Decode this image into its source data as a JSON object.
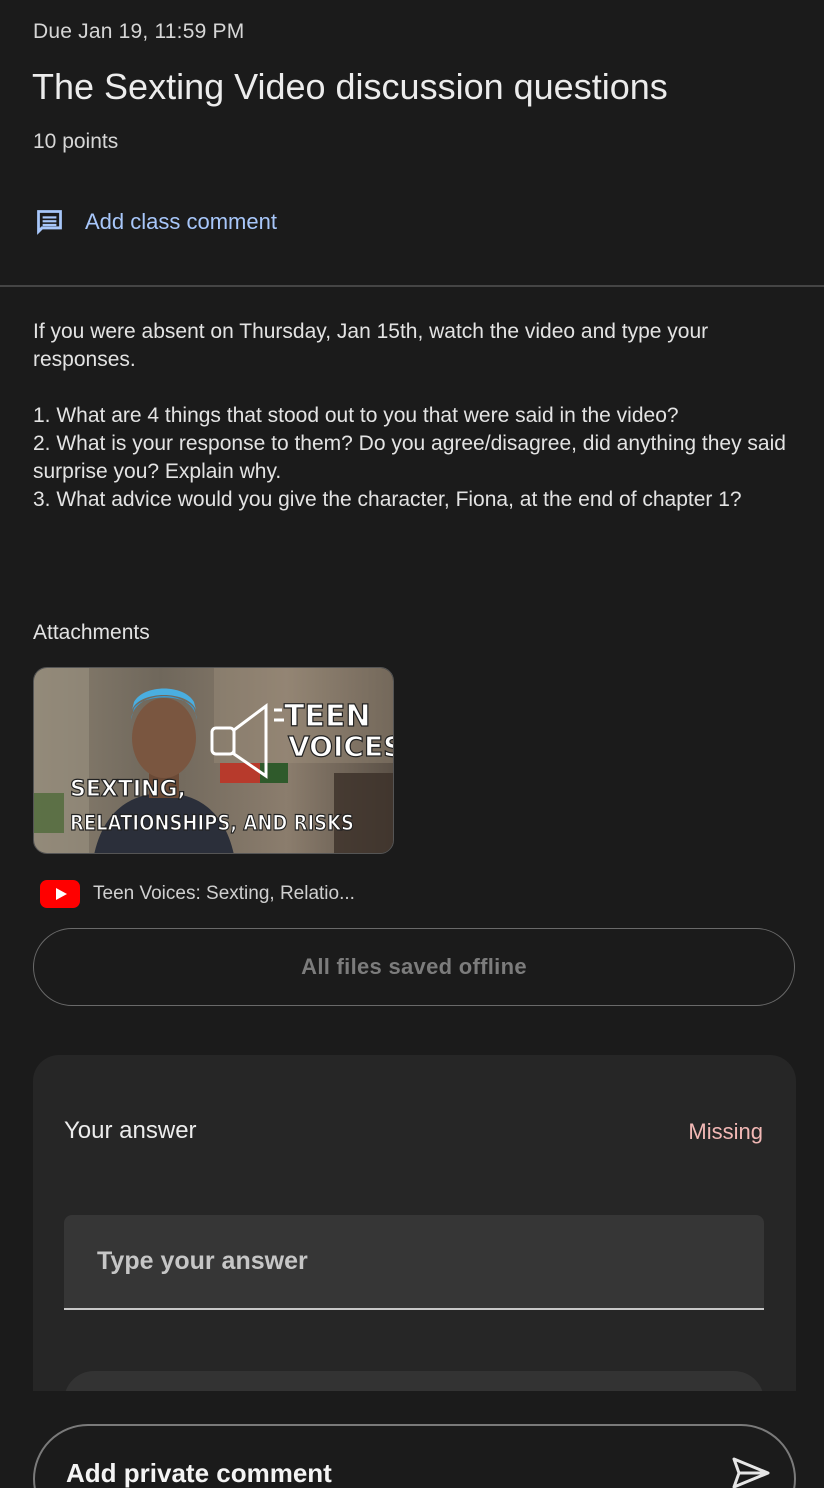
{
  "header": {
    "due": "Due Jan 19, 11:59 PM",
    "title": "The Sexting Video discussion questions",
    "points": "10 points"
  },
  "class_comment": {
    "icon": "comment-icon",
    "label": "Add class comment",
    "accent": "#a8c7fa"
  },
  "instructions": "If you were absent on Thursday, Jan 15th, watch the video and type your responses.\n\n1. What are 4 things that stood out to you that were said in the video?\n2. What is your response to them? Do you agree/disagree, did anything they said surprise you? Explain why.\n3. What advice would you give the character, Fiona, at the end of chapter 1?",
  "attachments": {
    "heading": "Attachments",
    "items": [
      {
        "type": "youtube",
        "icon": "youtube-icon",
        "title": "Teen Voices: Sexting, Relatio...",
        "thumbnail_text": {
          "line1": "TEEN",
          "line2": "VOICES",
          "line3": "SEXTING,",
          "line4": "RELATIONSHIPS, AND RISKS"
        }
      }
    ],
    "offline_button": "All files saved offline"
  },
  "your_work": {
    "title": "Your answer",
    "status": "Missing",
    "status_color": "#f2b8b5",
    "answer_placeholder": "Type your answer"
  },
  "private_comment": {
    "label": "Add private comment",
    "icon": "send-icon"
  }
}
